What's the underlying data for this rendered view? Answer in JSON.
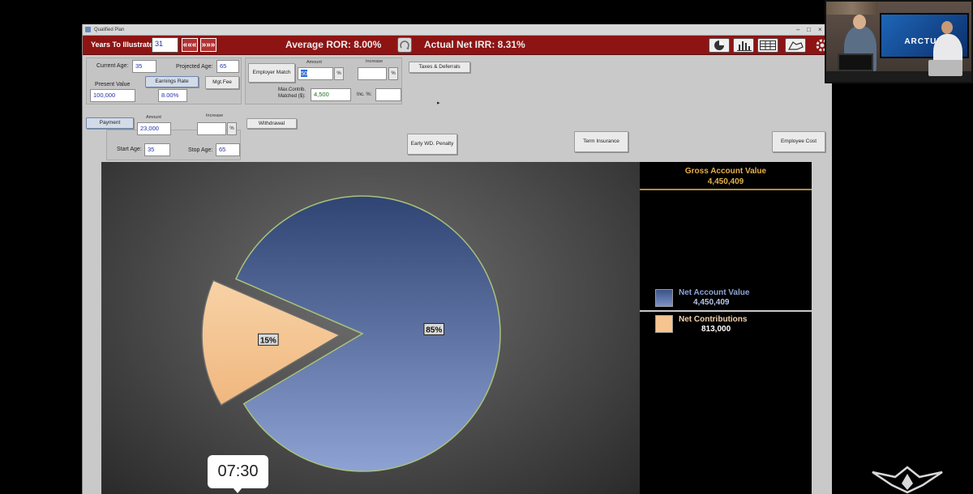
{
  "window": {
    "title": "Qualified Plan"
  },
  "toolbar": {
    "years_label": "Years To Illustrate:",
    "years_value": "31",
    "prev_label": "«««",
    "next_label": "»»»",
    "average_ror": "Average ROR: 8.00%",
    "actual_irr": "Actual Net IRR: 8.31%"
  },
  "inputs": {
    "current_age_label": "Current Age:",
    "current_age": "35",
    "projected_age_label": "Projected Age:",
    "projected_age": "65",
    "present_value_label": "Present Value",
    "present_value": "100,000",
    "earnings_rate_label": "Earnings Rate",
    "earnings_rate": "8.00%",
    "mgt_fee_label": "Mgt.Fee",
    "employer_match_label": "Employer Match",
    "amount_header": "Amount",
    "increase_header": "Increase",
    "employer_match_amount": "50",
    "pct_symbol": "%",
    "max_contrib_label_1": "Max.Contrib.",
    "max_contrib_label_2": "Matched ($):",
    "max_contrib": "4,500",
    "inc_label": "Inc. %:",
    "taxes_deferrals_label": "Taxes & Deferrals",
    "payment_label": "Payment",
    "payment_amount": "23,000",
    "start_age_label": "Start Age:",
    "start_age": "35",
    "stop_age_label": "Stop Age:",
    "stop_age": "65",
    "withdrawal_label": "Withdrawal",
    "early_wd_label": "Early WD. Penalty",
    "term_insurance_label": "Term Insurance",
    "employee_cost_label": "Employee Cost"
  },
  "legend": {
    "gross_title": "Gross Account Value",
    "gross_value": "4,450,409",
    "net_account_label": "Net Account Value",
    "net_account_value": "4,450,409",
    "net_contrib_label": "Net Contributions",
    "net_contrib_value": "813,000"
  },
  "colors": {
    "toolbar_red": "#8e1414",
    "legend_gold": "#e6b04a",
    "net_account_blue": "#5a72a8",
    "net_contrib_peach": "#f6c48e"
  },
  "chart_data": {
    "type": "pie",
    "categories": [
      "Net Account Value",
      "Net Contributions"
    ],
    "values": [
      85,
      15
    ],
    "labels": [
      "85%",
      "15%"
    ],
    "colors": [
      "#4f66a0",
      "#f3c290"
    ],
    "exploded": [
      false,
      true
    ]
  },
  "video": {
    "timestamp": "07:30"
  },
  "webcam": {
    "brand": "ARCTUM"
  }
}
